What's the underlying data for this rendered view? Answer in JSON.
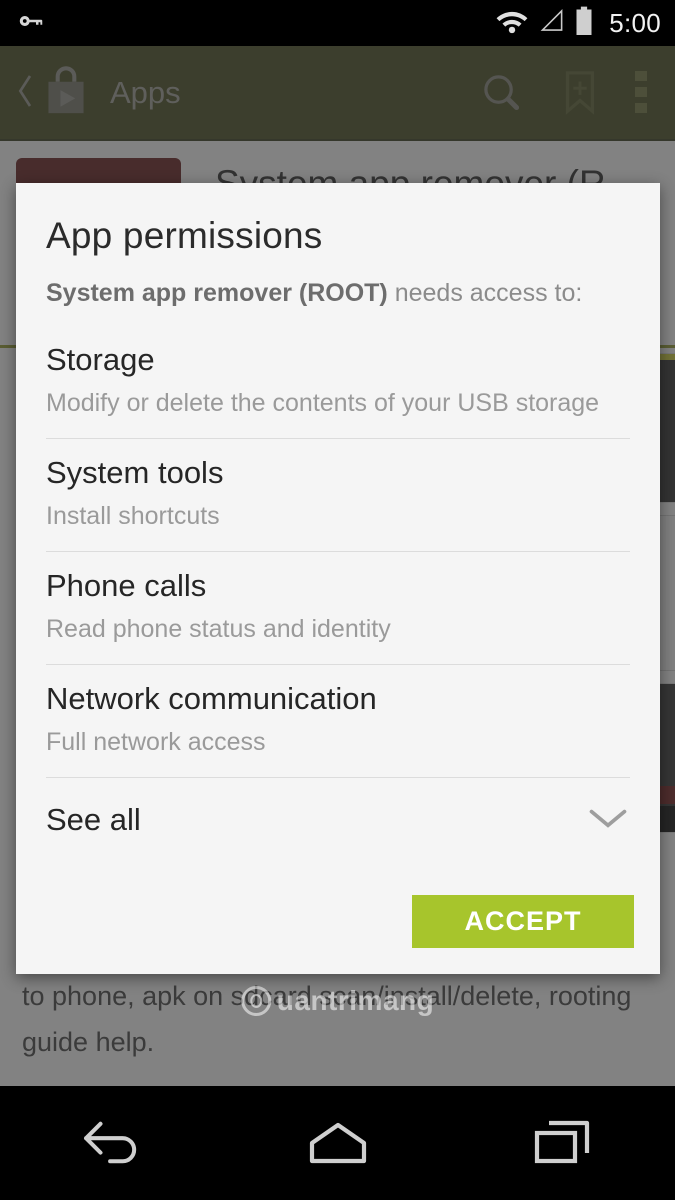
{
  "status_bar": {
    "time": "5:00",
    "icons": [
      "vpn-key-icon",
      "wifi-icon",
      "cellular-signal-icon",
      "battery-icon"
    ]
  },
  "action_bar": {
    "title": "Apps",
    "back_icon": "back-chevron-icon",
    "app_icon": "play-store-icon",
    "search_icon": "search-icon",
    "wishlist_icon": "bookmark-add-icon",
    "overflow_icon": "overflow-menu-icon",
    "background_color": "#3e4317"
  },
  "app_detail": {
    "app_title": "System app remover (R...",
    "description": "We provide not only system app remover, but also user app uninstaller, move app to sdcard, move app to phone, apk on sdcard scan/install/delete, rooting guide help."
  },
  "watermark": {
    "text": "uantrimang"
  },
  "dialog": {
    "title": "App permissions",
    "subtitle_app": "System app remover (ROOT)",
    "subtitle_rest": " needs access to:",
    "permissions": [
      {
        "name": "Storage",
        "desc": "Modify or delete the contents of your USB storage"
      },
      {
        "name": "System tools",
        "desc": "Install shortcuts"
      },
      {
        "name": "Phone calls",
        "desc": "Read phone status and identity"
      },
      {
        "name": "Network communication",
        "desc": "Full network access"
      }
    ],
    "see_all_label": "See all",
    "see_all_icon": "chevron-down-icon",
    "accept_label": "ACCEPT",
    "accept_color": "#a7c52c"
  },
  "nav_bar": {
    "back_icon": "nav-back-icon",
    "home_icon": "nav-home-icon",
    "recents_icon": "nav-recents-icon"
  }
}
